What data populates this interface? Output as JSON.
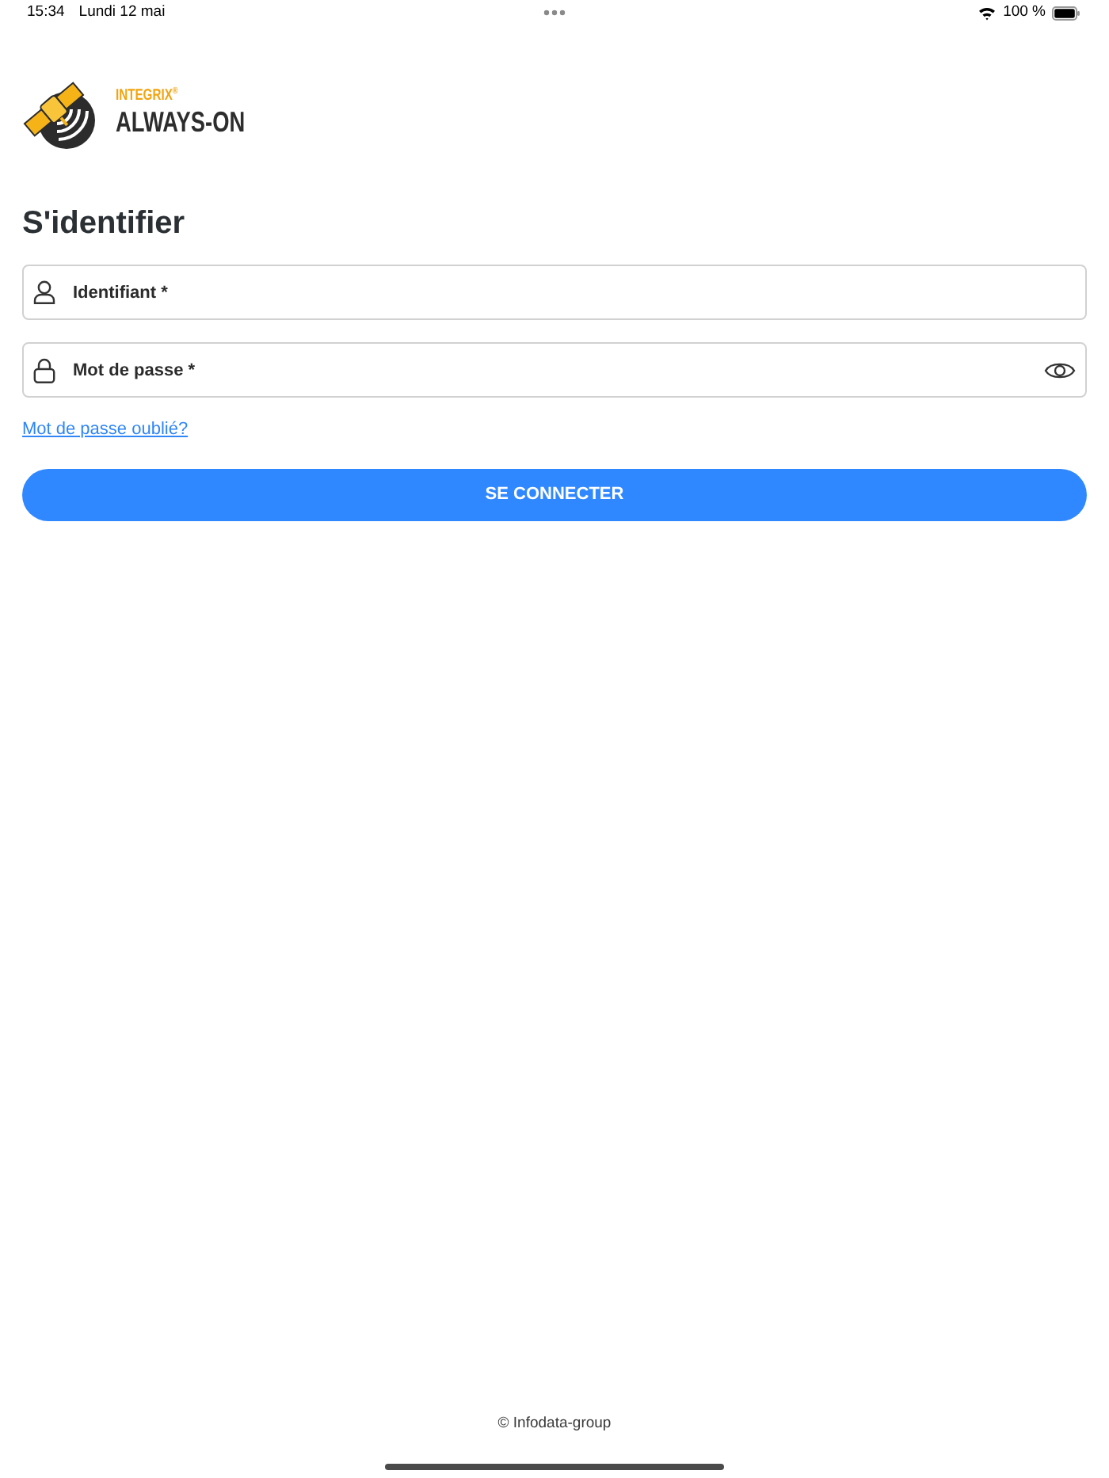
{
  "status_bar": {
    "time": "15:34",
    "date": "Lundi 12 mai",
    "battery": "100 %"
  },
  "logo": {
    "brand": "INTEGRIX$^{®}$",
    "product": "ALWAYS-ON"
  },
  "title": "S'identifier",
  "fields": [
    {
      "kind": "username",
      "placeholder": "Identifiant *"
    },
    {
      "kind": "password",
      "placeholder": "Mot de passe *"
    }
  ],
  "forgot_link": "Mot de passe oublié?",
  "submit_button": "SE CONNECTER",
  "footer": "© Infodata-group"
}
